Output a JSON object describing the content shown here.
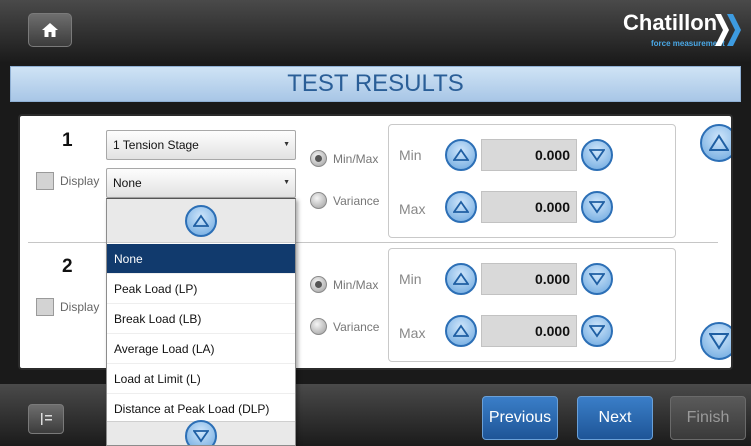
{
  "header": {
    "brand_name": "Chatillon",
    "brand_tagline": "force measurement",
    "home_icon": "home-icon"
  },
  "title": "TEST RESULTS",
  "rows": [
    {
      "number": "1",
      "stage_select": "1  Tension Stage",
      "result_select": "None",
      "display_label": "Display",
      "mode_minmax": "Min/Max",
      "mode_variance": "Variance",
      "min_label": "Min",
      "max_label": "Max",
      "min_value": "0.000",
      "max_value": "0.000"
    },
    {
      "number": "2",
      "display_label": "Display",
      "mode_minmax": "Min/Max",
      "mode_variance": "Variance",
      "min_label": "Min",
      "max_label": "Max",
      "min_value": "0.000",
      "max_value": "0.000"
    }
  ],
  "dropdown_list": {
    "items": [
      "None",
      "Peak Load (LP)",
      "Break Load (LB)",
      "Average Load (LA)",
      "Load at Limit (L)",
      "Distance at Peak Load (DLP)"
    ],
    "selected": "None"
  },
  "footer": {
    "previous_label": "Previous",
    "next_label": "Next",
    "finish_label": "Finish"
  },
  "colors": {
    "accent_blue": "#2c6fb6",
    "selected_item": "#113a6d",
    "title_text": "#2a5e97"
  }
}
